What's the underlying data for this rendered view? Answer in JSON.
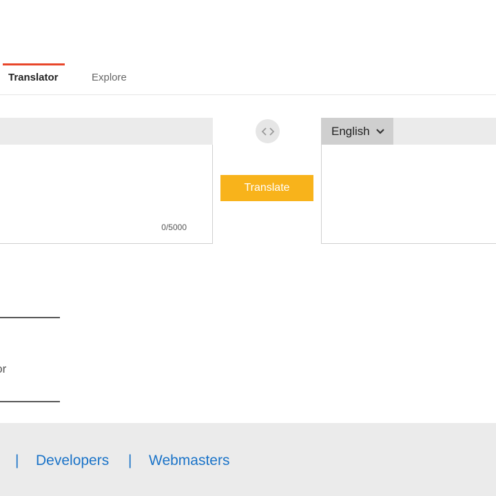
{
  "tabs": {
    "translator_label": "Translator",
    "explore_label": "Explore"
  },
  "source": {
    "char_count": "0/5000"
  },
  "translate_button": {
    "label": "Translate"
  },
  "target": {
    "language": "English"
  },
  "side_partial_text": "ator",
  "footer": {
    "separator": "|",
    "developers_label": "Developers",
    "webmasters_label": "Webmasters"
  },
  "colors": {
    "accent_tab": "#e8462a",
    "translate_button": "#f8b31b",
    "footer_link": "#1a73c8"
  },
  "icons": {
    "swap": "swap-icon",
    "dropdown": "chevron-down-icon"
  }
}
